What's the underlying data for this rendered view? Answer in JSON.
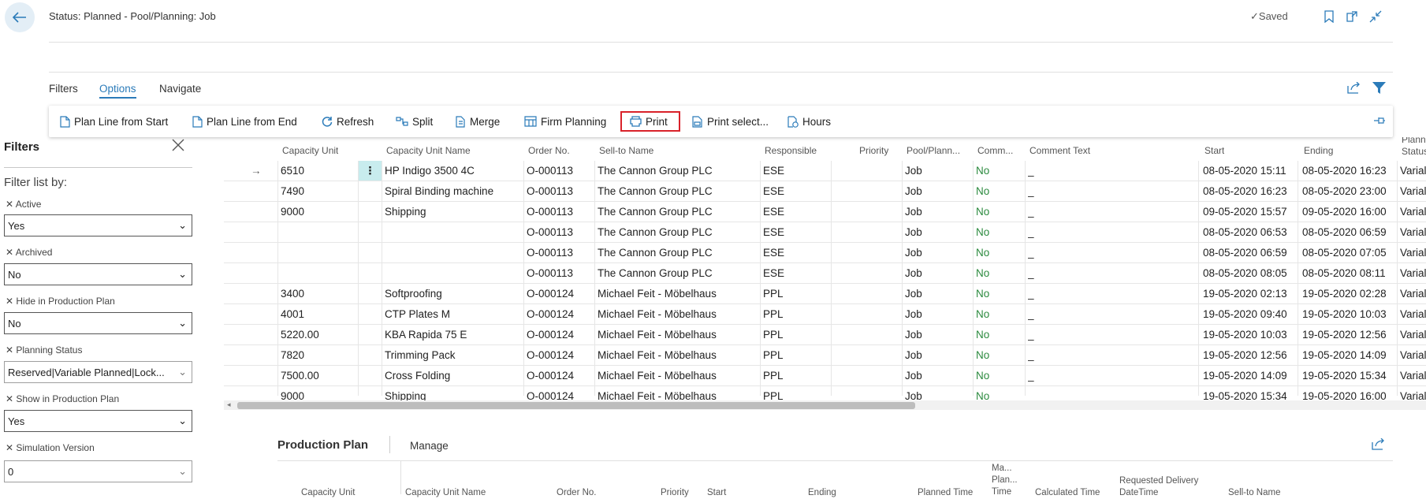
{
  "header": {
    "title": "Status: Planned - Pool/Planning: Job",
    "saved_label": "Saved"
  },
  "nav_tabs": [
    {
      "label": "Filters"
    },
    {
      "label": "Options",
      "active": true
    },
    {
      "label": "Navigate"
    }
  ],
  "actions": [
    {
      "label": "Plan Line from Start",
      "icon": "document-icon"
    },
    {
      "label": "Plan Line from End",
      "icon": "document-icon"
    },
    {
      "label": "Refresh",
      "icon": "refresh-icon"
    },
    {
      "label": "Split",
      "icon": "split-icon"
    },
    {
      "label": "Merge",
      "icon": "merge-icon"
    },
    {
      "label": "Firm Planning",
      "icon": "firm-planning-icon"
    },
    {
      "label": "Print",
      "icon": "printer-icon",
      "highlighted": true
    },
    {
      "label": "Print select...",
      "icon": "print-select-icon"
    },
    {
      "label": "Hours",
      "icon": "hours-icon"
    }
  ],
  "filters_pane": {
    "title": "Filters",
    "subtitle": "Filter list by:",
    "filters": [
      {
        "label": "Active",
        "value": "Yes"
      },
      {
        "label": "Archived",
        "value": "No"
      },
      {
        "label": "Hide in Production Plan",
        "value": "No"
      },
      {
        "label": "Planning Status",
        "value": "Reserved|Variable Planned|Lock..."
      },
      {
        "label": "Show in Production Plan",
        "value": "Yes"
      },
      {
        "label": "Simulation Version",
        "value": "0"
      }
    ]
  },
  "grid": {
    "columns": [
      "Capacity Unit",
      "Capacity Unit Name",
      "Order No.",
      "Sell-to Name",
      "Responsible",
      "Priority",
      "Pool/Plann...",
      "Comm...",
      "Comment Text",
      "Start",
      "Ending",
      "Planni...",
      "Status"
    ],
    "rows": [
      {
        "cap": "6510",
        "name": "HP Indigo 3500 4C",
        "order": "O-000113",
        "sell": "The Cannon Group PLC",
        "resp": "ESE",
        "pool": "Job",
        "comm": "No",
        "text": "_",
        "start": "08-05-2020 15:11",
        "end": "08-05-2020 16:23",
        "plan": "Varial"
      },
      {
        "cap": "7490",
        "name": "Spiral Binding machine",
        "order": "O-000113",
        "sell": "The Cannon Group PLC",
        "resp": "ESE",
        "pool": "Job",
        "comm": "No",
        "text": "_",
        "start": "08-05-2020 16:23",
        "end": "08-05-2020 23:00",
        "plan": "Varial"
      },
      {
        "cap": "9000",
        "name": "Shipping",
        "order": "O-000113",
        "sell": "The Cannon Group PLC",
        "resp": "ESE",
        "pool": "Job",
        "comm": "No",
        "text": "_",
        "start": "09-05-2020 15:57",
        "end": "09-05-2020 16:00",
        "plan": "Varial"
      },
      {
        "cap": "",
        "name": "",
        "order": "O-000113",
        "sell": "The Cannon Group PLC",
        "resp": "ESE",
        "pool": "Job",
        "comm": "No",
        "text": "_",
        "start": "08-05-2020 06:53",
        "end": "08-05-2020 06:59",
        "plan": "Varial"
      },
      {
        "cap": "",
        "name": "",
        "order": "O-000113",
        "sell": "The Cannon Group PLC",
        "resp": "ESE",
        "pool": "Job",
        "comm": "No",
        "text": "_",
        "start": "08-05-2020 06:59",
        "end": "08-05-2020 07:05",
        "plan": "Varial"
      },
      {
        "cap": "",
        "name": "",
        "order": "O-000113",
        "sell": "The Cannon Group PLC",
        "resp": "ESE",
        "pool": "Job",
        "comm": "No",
        "text": "_",
        "start": "08-05-2020 08:05",
        "end": "08-05-2020 08:11",
        "plan": "Varial"
      },
      {
        "cap": "3400",
        "name": "Softproofing",
        "order": "O-000124",
        "sell": "Michael Feit - Möbelhaus",
        "resp": "PPL",
        "pool": "Job",
        "comm": "No",
        "text": "_",
        "start": "19-05-2020 02:13",
        "end": "19-05-2020 02:28",
        "plan": "Varial"
      },
      {
        "cap": "4001",
        "name": "CTP Plates M",
        "order": "O-000124",
        "sell": "Michael Feit - Möbelhaus",
        "resp": "PPL",
        "pool": "Job",
        "comm": "No",
        "text": "_",
        "start": "19-05-2020 09:40",
        "end": "19-05-2020 10:03",
        "plan": "Varial"
      },
      {
        "cap": "5220.00",
        "name": "KBA Rapida 75 E",
        "order": "O-000124",
        "sell": "Michael Feit - Möbelhaus",
        "resp": "PPL",
        "pool": "Job",
        "comm": "No",
        "text": "_",
        "start": "19-05-2020 10:03",
        "end": "19-05-2020 12:56",
        "plan": "Varial"
      },
      {
        "cap": "7820",
        "name": "Trimming Pack",
        "order": "O-000124",
        "sell": "Michael Feit - Möbelhaus",
        "resp": "PPL",
        "pool": "Job",
        "comm": "No",
        "text": "_",
        "start": "19-05-2020 12:56",
        "end": "19-05-2020 14:09",
        "plan": "Varial"
      },
      {
        "cap": "7500.00",
        "name": "Cross Folding",
        "order": "O-000124",
        "sell": "Michael Feit - Möbelhaus",
        "resp": "PPL",
        "pool": "Job",
        "comm": "No",
        "text": "_",
        "start": "19-05-2020 14:09",
        "end": "19-05-2020 15:34",
        "plan": "Varial"
      },
      {
        "cap": "9000",
        "name": "Shipping",
        "order": "O-000124",
        "sell": "Michael Feit - Möbelhaus",
        "resp": "PPL",
        "pool": "Job",
        "comm": "No",
        "text": "_",
        "start": "19-05-2020 15:34",
        "end": "19-05-2020 16:00",
        "plan": "Varial"
      }
    ]
  },
  "production_plan": {
    "title": "Production Plan",
    "manage_label": "Manage",
    "columns": {
      "cap": "Capacity Unit",
      "name": "Capacity Unit Name",
      "order": "Order No.",
      "priority": "Priority",
      "start": "Start",
      "ending": "Ending",
      "planned": "Planned Time",
      "ma1": "Ma...",
      "ma2": "Plan...",
      "ma3": "Time",
      "calc": "Calculated Time",
      "req1": "Requested Delivery",
      "req2": "DateTime",
      "sell": "Sell-to Name"
    }
  }
}
